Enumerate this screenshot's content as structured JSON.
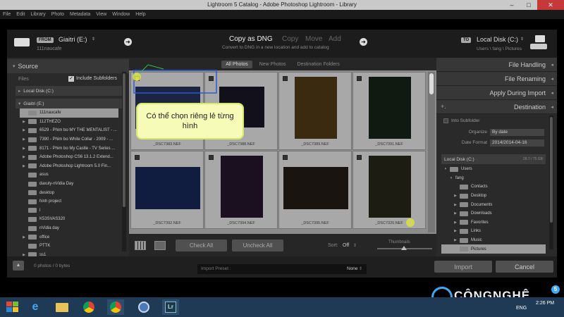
{
  "window": {
    "title": "Lightroom 5 Catalog - Adobe Photoshop Lightroom - Library"
  },
  "menu": [
    "File",
    "Edit",
    "Library",
    "Photo",
    "Metadata",
    "View",
    "Window",
    "Help"
  ],
  "top": {
    "from_badge": "FROM",
    "from_source": "Giaitri (E:)",
    "from_arrow": "⇕",
    "from_path": "111naucafe",
    "mode_active": "Copy as DNG",
    "mode_copy": "Copy",
    "mode_move": "Move",
    "mode_add": "Add",
    "mode_desc": "Convert to DNG in a new location and add to catalog",
    "to_badge": "TO",
    "to_dest": "Local Disk (C:)",
    "to_arrow": "⇕",
    "to_path": "Users \\ fang \\ Pictures"
  },
  "left": {
    "header": "Source",
    "files_label": "Files",
    "include_sub": "Include Subfolders",
    "local_disk": "Local Disk (C:)",
    "giaitri": "Giaitri (E:)",
    "folders": [
      "111naucafe",
      "112THEZO",
      "6529 - Phim bo MY THE MENTALIST - ...",
      "7390 - Phim bo White Collar - 2009 - ...",
      "8171 - Phim bo My Castle - TV Series ...",
      "Adobe Photoshop CS6 13.1.2 Extend...",
      "Adobe Photoshop Lightroom 5.0 Fin...",
      "asus",
      "daxuly-nVidia Day",
      "desktop",
      "hinh project",
      "l",
      "K53SVAS320",
      "nVidia day",
      "office",
      "PTTK",
      "ss1"
    ]
  },
  "grid": {
    "tabs": [
      "All Photos",
      "New Photos",
      "Destination Folders"
    ],
    "photos": [
      "_DSC7383.NEF",
      "_DSC7388.NEF",
      "_DSC7389.NEF",
      "_DSC7391.NEF",
      "_DSC7392.NEF",
      "_DSC7394.NEF",
      "_DSC7395.NEF",
      "_DSC7320.NEF"
    ]
  },
  "bottom": {
    "check_all": "Check All",
    "uncheck_all": "Uncheck All",
    "sort_label": "Sort:",
    "sort_value": "Off",
    "thumbnails": "Thumbnails"
  },
  "right": {
    "sections": [
      "File Handling",
      "File Renaming",
      "Apply During Import",
      "Destination"
    ],
    "into_subfolder": "Into Subfolder",
    "organize_label": "Organize",
    "organize_value": "By date",
    "date_format_label": "Date Format",
    "date_format_value": "2014/2014-04-16",
    "disk": "Local Disk (C:)",
    "disk_size": "28.7 / 75 GB",
    "tree": [
      "Users",
      "fang",
      "Contacts",
      "Desktop",
      "Documents",
      "Downloads",
      "Favorites",
      "Links",
      "Music",
      "Pictures"
    ]
  },
  "footer": {
    "count": "0 photos / 0 bytes",
    "preset_label": "Import Preset :",
    "preset_value": "None",
    "import": "Import",
    "cancel": "Cancel"
  },
  "callout": "Có thể chọn riêng lẻ từng hình",
  "taskbar": {
    "lang": "ENG",
    "time": "2:26 PM",
    "logo": "CÔNGNGHỆ",
    "logo_num": "5"
  }
}
